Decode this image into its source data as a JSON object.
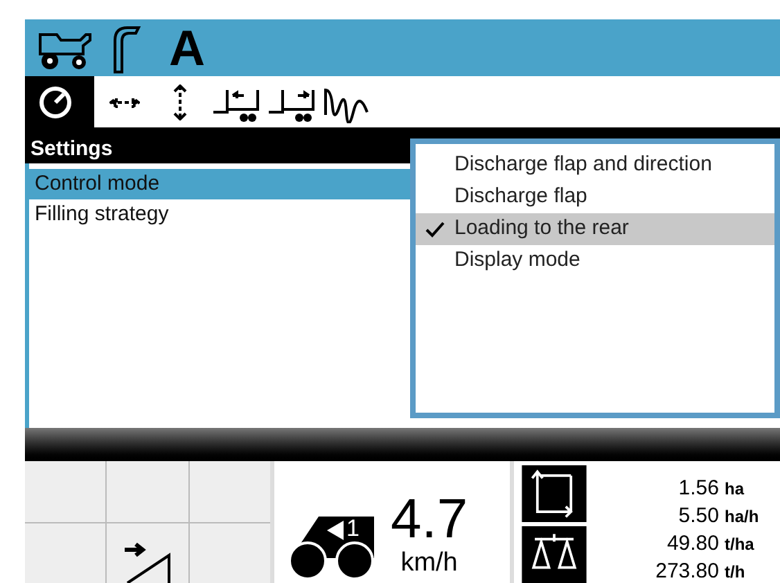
{
  "header": {
    "mode_letter": "A"
  },
  "toolbar": {
    "tabs": [
      {
        "kind": "gauge",
        "selected": true
      },
      {
        "kind": "horizontal",
        "selected": false
      },
      {
        "kind": "vertical",
        "selected": false
      },
      {
        "kind": "trailer_left",
        "selected": false
      },
      {
        "kind": "trailer_right",
        "selected": false
      },
      {
        "kind": "wave",
        "selected": false
      }
    ]
  },
  "settings": {
    "title": "Settings",
    "items": [
      {
        "label": "Control mode",
        "selected": true
      },
      {
        "label": "Filling strategy",
        "selected": false
      }
    ]
  },
  "dropdown": {
    "options": [
      {
        "label": "Discharge flap and direction",
        "checked": false
      },
      {
        "label": "Discharge flap",
        "checked": false
      },
      {
        "label": "Loading to the rear",
        "checked": true
      },
      {
        "label": "Display mode",
        "checked": false
      }
    ]
  },
  "speed": {
    "gear": "1",
    "value": "4.7",
    "unit": "km/h"
  },
  "stats": [
    {
      "value": "1.56",
      "unit": "ha"
    },
    {
      "value": "5.50",
      "unit": "ha/h"
    },
    {
      "value": "49.80",
      "unit": "t/ha"
    },
    {
      "value": "273.80",
      "unit": "t/h"
    }
  ]
}
